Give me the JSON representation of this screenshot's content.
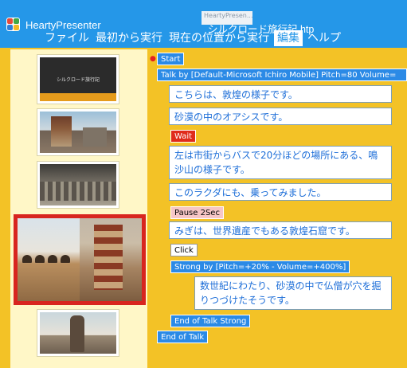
{
  "titlebar": {
    "app_name": "HeartyPresenter",
    "hidden_tab_line1": "HeartyPresen...",
    "hidden_tab_line2": "",
    "document_title": "シルクロード旅行記.htp"
  },
  "menu": {
    "items": [
      {
        "label": "ファイル"
      },
      {
        "label": "最初から実行"
      },
      {
        "label": "現在の位置から実行"
      },
      {
        "label": "編集"
      },
      {
        "label": "ヘルプ"
      }
    ],
    "active_index": 3
  },
  "thumbnails": {
    "slide1_caption": "シルクロード旅行記"
  },
  "script": {
    "start": "Start",
    "talk": "Talk by [Default-Microsoft Ichiro Mobile]  Pitch=80  Volume=",
    "line1": "こちらは、敦煌の様子です。",
    "line2": "砂漠の中のオアシスです。",
    "wait": "Wait",
    "line3": "左は市街からバスで20分ほどの場所にある、鳴沙山の様子です。",
    "line4": "このラクダにも、乗ってみました。",
    "pause": "Pause 2Sec",
    "line5": "みぎは、世界遺産でもある敦煌石窟です。",
    "click": "Click",
    "strong": "Strong by [Pitch=+20% - Volume=+400%]",
    "line6": "数世紀にわたり、砂漠の中で仏僧が穴を掘りつづけたそうです。",
    "end_strong": "End of Talk Strong",
    "end_talk": "End of Talk"
  }
}
